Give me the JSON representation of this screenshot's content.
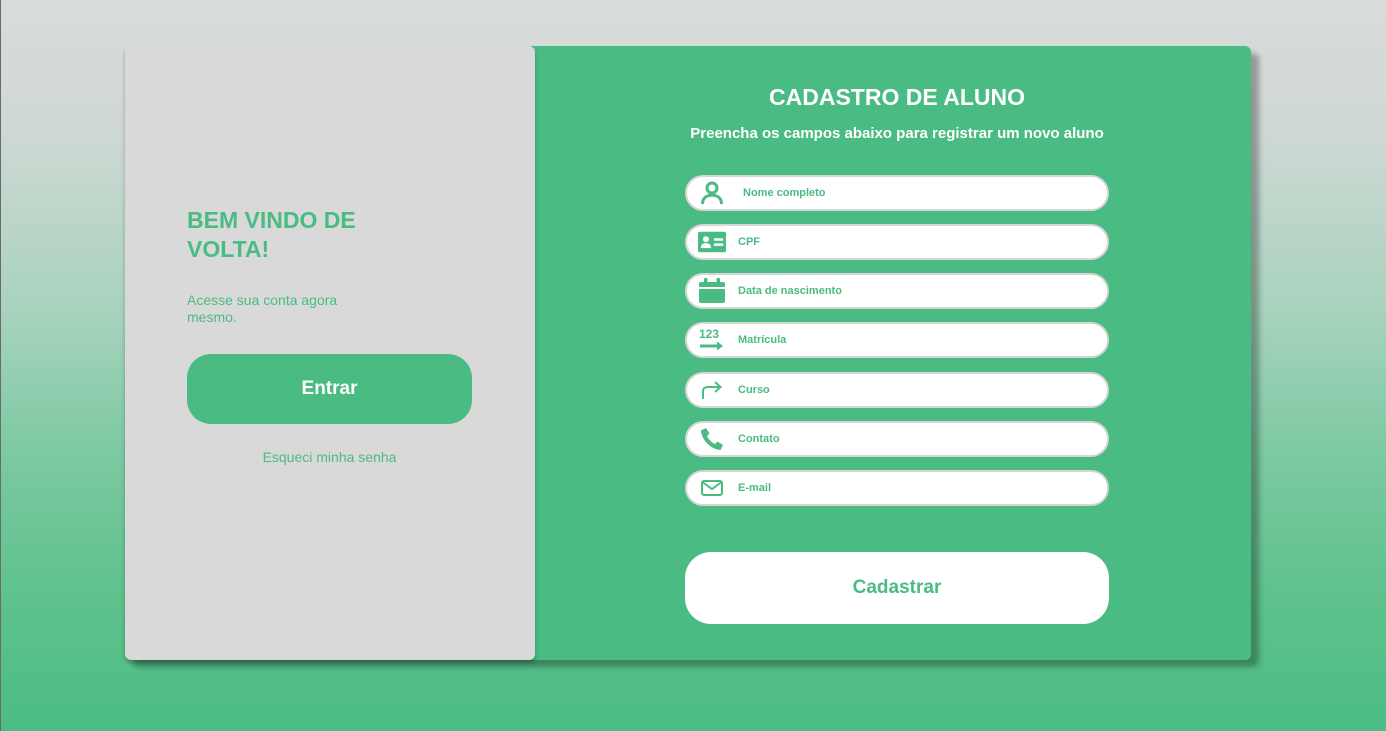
{
  "colors": {
    "accent": "#4abb82",
    "panel_left": "#d9d9d9",
    "field_bg": "#ffffff",
    "field_border": "#d6d6d6",
    "text_on_accent": "#ffffff"
  },
  "login_panel": {
    "title": "BEM VINDO DE VOLTA!",
    "subtitle": "Acesse sua conta agora mesmo.",
    "enter_button": "Entrar",
    "forgot_link": "Esqueci minha senha"
  },
  "register_form": {
    "title": "CADASTRO DE ALUNO",
    "subtitle": "Preencha os campos abaixo para registrar um novo aluno",
    "fields": [
      {
        "icon": "user-icon",
        "placeholder": "Nome completo",
        "value": ""
      },
      {
        "icon": "id-card-icon",
        "placeholder": "CPF",
        "value": ""
      },
      {
        "icon": "calendar-icon",
        "placeholder": "Data de nascimento",
        "value": ""
      },
      {
        "icon": "numbers-icon",
        "placeholder": "Matrícula",
        "value": ""
      },
      {
        "icon": "forward-arrow-icon",
        "placeholder": "Curso",
        "value": ""
      },
      {
        "icon": "phone-icon",
        "placeholder": "Contato",
        "value": ""
      },
      {
        "icon": "mail-icon",
        "placeholder": "E-mail",
        "value": ""
      }
    ],
    "submit_button": "Cadastrar"
  }
}
